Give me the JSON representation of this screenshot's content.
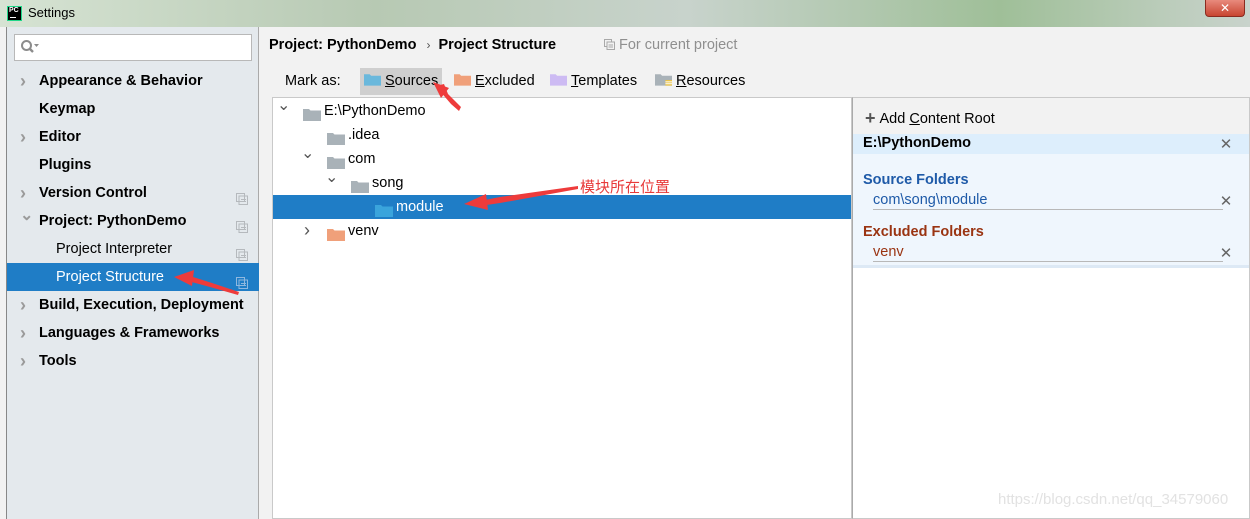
{
  "window": {
    "app_icon": "pycharm-logo-icon",
    "app_icon_text": "PC",
    "title": "Settings",
    "close_label": "✕"
  },
  "sidebar": {
    "search": {
      "value": "",
      "placeholder": "",
      "icon": "search-icon"
    },
    "items": [
      {
        "label": "Appearance & Behavior",
        "expandable": true,
        "expanded": false,
        "bold": true,
        "project_scoped": false
      },
      {
        "label": "Keymap",
        "expandable": false,
        "bold": true,
        "project_scoped": false
      },
      {
        "label": "Editor",
        "expandable": true,
        "expanded": false,
        "bold": true,
        "project_scoped": false
      },
      {
        "label": "Plugins",
        "expandable": false,
        "bold": true,
        "project_scoped": false
      },
      {
        "label": "Version Control",
        "expandable": true,
        "expanded": false,
        "bold": true,
        "project_scoped": true
      },
      {
        "label": "Project: PythonDemo",
        "expandable": true,
        "expanded": true,
        "bold": true,
        "project_scoped": true
      },
      {
        "label": "Project Interpreter",
        "expandable": false,
        "bold": false,
        "sub": true,
        "project_scoped": true
      },
      {
        "label": "Project Structure",
        "expandable": false,
        "bold": false,
        "sub": true,
        "selected": true,
        "project_scoped": true
      },
      {
        "label": "Build, Execution, Deployment",
        "expandable": true,
        "expanded": false,
        "bold": true,
        "project_scoped": false
      },
      {
        "label": "Languages & Frameworks",
        "expandable": true,
        "expanded": false,
        "bold": true,
        "project_scoped": false
      },
      {
        "label": "Tools",
        "expandable": true,
        "expanded": false,
        "bold": true,
        "project_scoped": false
      }
    ]
  },
  "header": {
    "breadcrumb": [
      "Project: PythonDemo",
      "Project Structure"
    ],
    "breadcrumb_separator": "›",
    "scope_note": "For current project"
  },
  "mark_as": {
    "label": "Mark as:",
    "buttons": [
      {
        "mnemonic": "S",
        "rest": "ources",
        "label": "Sources",
        "color": "#6ab8dc",
        "active": true
      },
      {
        "mnemonic": "E",
        "rest": "xcluded",
        "label": "Excluded",
        "color": "#f0a07a",
        "active": false
      },
      {
        "mnemonic": "T",
        "rest": "emplates",
        "label": "Templates",
        "color": "#cdbbf3",
        "active": false
      },
      {
        "mnemonic": "R",
        "rest": "esources",
        "label": "Resources",
        "color": "#a9b2b8",
        "active": false
      }
    ]
  },
  "tree": {
    "nodes": [
      {
        "label": "E:\\PythonDemo",
        "depth": 0,
        "toggle": "expanded",
        "folder_color": "#a9b2b8"
      },
      {
        "label": ".idea",
        "depth": 1,
        "toggle": "none",
        "folder_color": "#a9b2b8"
      },
      {
        "label": "com",
        "depth": 1,
        "toggle": "expanded",
        "folder_color": "#a9b2b8"
      },
      {
        "label": "song",
        "depth": 2,
        "toggle": "expanded",
        "folder_color": "#a9b2b8"
      },
      {
        "label": "module",
        "depth": 3,
        "toggle": "none",
        "folder_color": "#3aa4dc",
        "selected": true
      },
      {
        "label": "venv",
        "depth": 1,
        "toggle": "collapsed",
        "folder_color": "#f0a07a"
      }
    ]
  },
  "content_roots": {
    "add_label_prefix": "Add ",
    "add_label_mnemonic": "C",
    "add_label_rest": "ontent Root",
    "root": "E:\\PythonDemo",
    "source_title": "Source Folders",
    "source_color": "#1e5aa8",
    "source_folders": [
      "com\\song\\module"
    ],
    "excluded_title": "Excluded Folders",
    "excluded_color": "#9a3412",
    "excluded_folders": [
      "venv"
    ]
  },
  "annotation": {
    "text": "模块所在位置",
    "color": "#e83a3a"
  },
  "watermark": "https://blog.csdn.net/qq_34579060"
}
